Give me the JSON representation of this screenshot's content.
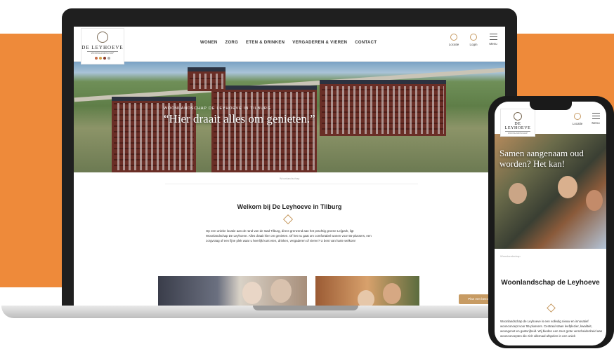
{
  "site": {
    "logo_name": "DE LEYHOEVE",
    "logo_sub": "WOONLANDSCHAP",
    "logo_dots": [
      "#c56b4a",
      "#d4a24b",
      "#8a3d2d",
      "#b0b0b0"
    ],
    "accent": "#c79b63"
  },
  "laptop": {
    "nav": [
      "WONEN",
      "ZORG",
      "ETEN & DRINKEN",
      "VERGADEREN & VIEREN",
      "CONTACT"
    ],
    "icons": [
      {
        "icon": "location-icon",
        "label": "Locatie"
      },
      {
        "icon": "login-icon",
        "label": "Login"
      },
      {
        "icon": "menu-icon",
        "label": "Menu"
      }
    ],
    "hero_eyebrow": "WOONLANDSCHAP DE LEYHOEVE IN TILBURG",
    "hero_title": "“Hier draait alles om genieten.”",
    "breadcrumb": "Woonlandschap",
    "welcome_title": "Welkom bij De Leyhoeve in Tilburg",
    "intro": "Op een unieke locatie aan de rand van de stad Tilburg, direct grenzend aan het prachtig groene Leijpark, ligt Woonlandschap De Leyhoeve. Alles draait hier om genieten. Of het nu gaat om comfortabel wonen voor 55-plussers, een zorgvraag of een fijne plek waar u heerlijk kunt eten, drinken, vergaderen of vieren? U bent van harte welkom!",
    "cta": "Plan een bezoek"
  },
  "phone": {
    "icons": [
      {
        "icon": "location-icon",
        "label": "Locatie"
      },
      {
        "icon": "menu-icon",
        "label": "Menu"
      }
    ],
    "hero_title": "Samen aangenaam oud worden? Het kan!",
    "breadcrumb": "Woonlandschap",
    "section_title": "Woonlandschap de Leyhoeve",
    "intro": "Woonlandschap de Leyhoeve is een volledig nieuw en innovatief woonconcept voor 55-plussers. Centraal staan leefplezier, kwaliteit, woongenot en gastvrijheid. Wij bieden een zeer grote verscheidenheid aan woonconcepten die zich allemaal afspelen in een uniek"
  }
}
